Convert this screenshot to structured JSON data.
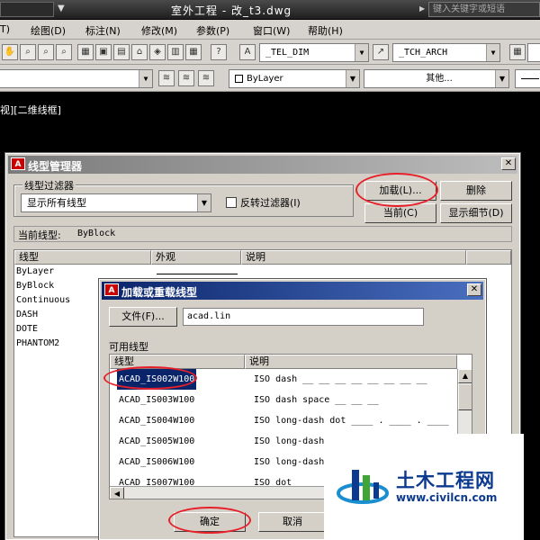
{
  "titlebar": {
    "title": "室外工程 - 改_t3.dwg",
    "search_placeholder": "键入关键字或短语"
  },
  "menubar": {
    "items": [
      "T)",
      "绘图(D)",
      "标注(N)",
      "修改(M)",
      "参数(P)",
      "窗口(W)",
      "帮助(H)"
    ]
  },
  "toolbar": {
    "dim_style": "_TEL_DIM",
    "text_style": "_TCH_ARCH",
    "color_combo": "ByLayer",
    "other_combo": "其他..."
  },
  "viewport_label": "视][二维线框]",
  "linetype_manager": {
    "title": "线型管理器",
    "filter_group": "线型过滤器",
    "filter_value": "显示所有线型",
    "invert_filter": "反转过滤器(I)",
    "load_button": "加载(L)...",
    "delete_button": "删除",
    "current_button": "当前(C)",
    "details_button": "显示细节(D)",
    "current_label": "当前线型:",
    "current_value": "ByBlock",
    "columns": [
      "线型",
      "外观",
      "说明"
    ],
    "linetypes": [
      "ByLayer",
      "ByBlock",
      "Continuous",
      "DASH",
      "DOTE",
      "PHANTOM2"
    ]
  },
  "load_dialog": {
    "title": "加载或重载线型",
    "file_button": "文件(F)...",
    "file_value": "acad.lin",
    "available_label": "可用线型",
    "columns": [
      "线型",
      "说明"
    ],
    "rows": [
      {
        "name": "ACAD_IS002W100",
        "desc": "ISO dash __ __ __ __ __ __ __ __"
      },
      {
        "name": "ACAD_IS003W100",
        "desc": "ISO dash space __    __    __"
      },
      {
        "name": "ACAD_IS004W100",
        "desc": "ISO long-dash dot ____ . ____ . ____ ."
      },
      {
        "name": "ACAD_IS005W100",
        "desc": "ISO long-dash"
      },
      {
        "name": "ACAD_IS006W100",
        "desc": "ISO long-dash"
      },
      {
        "name": "ACAD_IS007W100",
        "desc": "ISO dot"
      }
    ],
    "ok_button": "确定",
    "cancel_button": "取消"
  },
  "watermark": {
    "brand": "土木工程网",
    "url": "www.civilcn.com"
  },
  "colors": {
    "highlight_circle": "#e8202a",
    "selection": "#0a246a",
    "brand": "#0b3a8f"
  }
}
